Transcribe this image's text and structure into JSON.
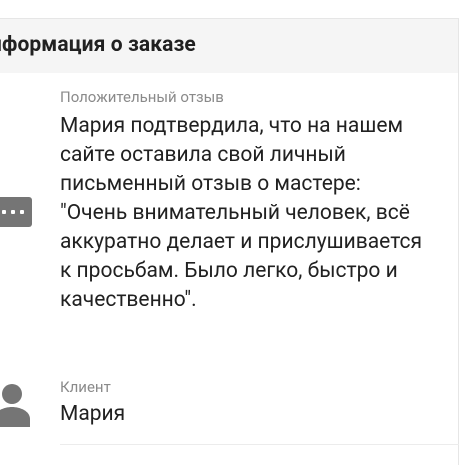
{
  "header": {
    "title": "нформация о заказе"
  },
  "review": {
    "label": "Положительный отзыв",
    "text": "Мария подтвердила, что на нашем\nсайте оставила свой личный\nписьменный отзыв о мастере:\n\"Очень внимательный человек, всё\nаккуратно делает и прислушивается\nк просьбам. Было легко, быстро и\nкачественно\"."
  },
  "client": {
    "label": "Клиент",
    "name": "Мария"
  },
  "icons": {
    "review": "chat-bubble-icon",
    "client": "person-icon"
  },
  "colors": {
    "header_bg": "#f5f5f5",
    "icon": "#757575",
    "label": "#8a8a8a",
    "text": "#212121"
  }
}
